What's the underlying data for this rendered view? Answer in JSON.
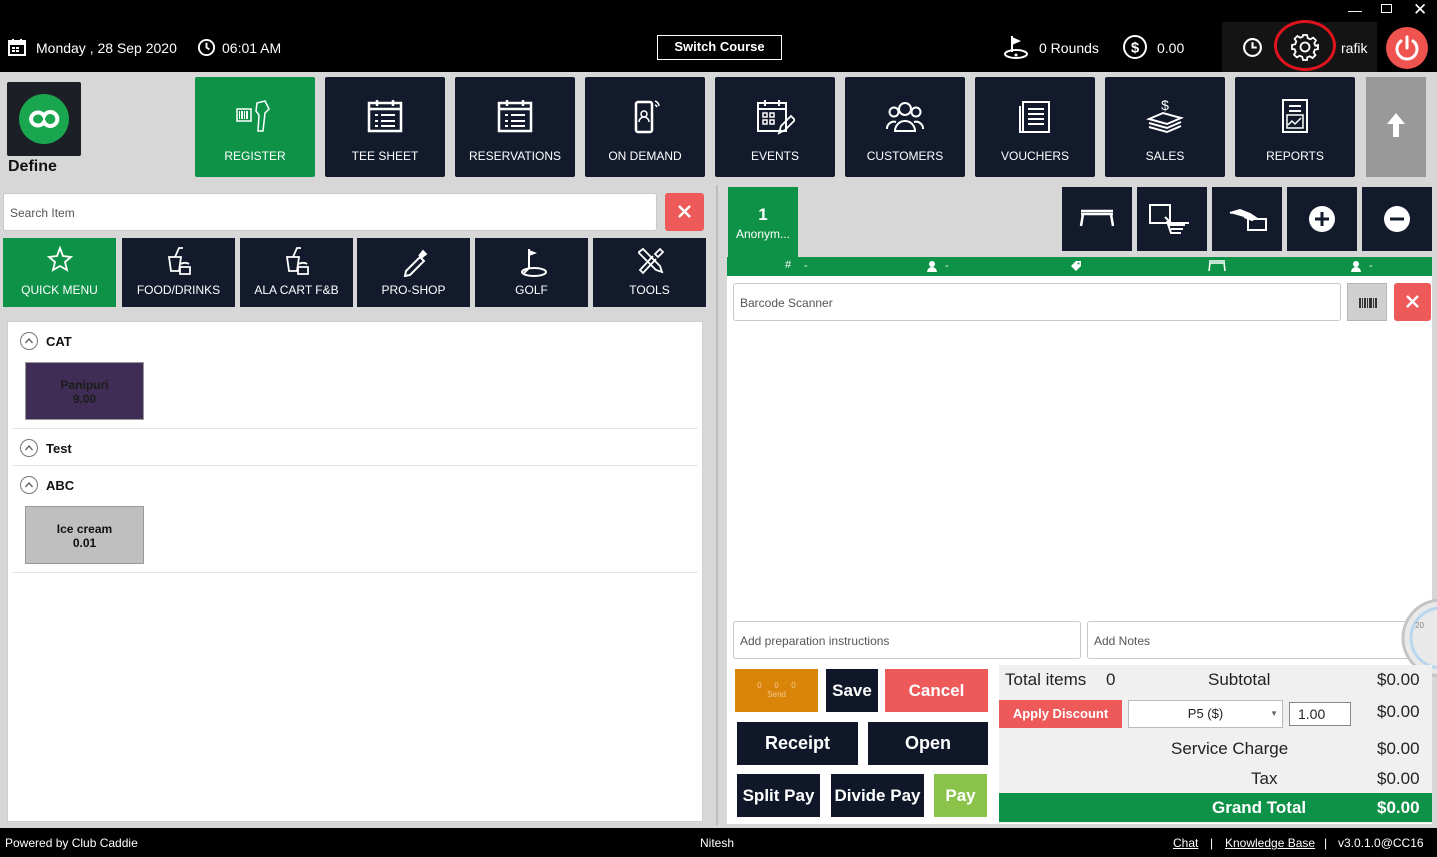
{
  "topbar": {
    "date": "Monday ,  28 Sep 2020",
    "time": "06:01 AM",
    "switch_course": "Switch Course",
    "rounds": "0 Rounds",
    "amount": "0.00",
    "user": "rafik"
  },
  "brand": {
    "label": "Define"
  },
  "nav": [
    {
      "label": "REGISTER",
      "icon": "barcode-scanner-icon"
    },
    {
      "label": "TEE SHEET",
      "icon": "calendar-list-icon"
    },
    {
      "label": "RESERVATIONS",
      "icon": "calendar-list-icon"
    },
    {
      "label": "ON DEMAND",
      "icon": "mobile-icon"
    },
    {
      "label": "EVENTS",
      "icon": "calendar-edit-icon"
    },
    {
      "label": "CUSTOMERS",
      "icon": "users-icon"
    },
    {
      "label": "VOUCHERS",
      "icon": "voucher-icon"
    },
    {
      "label": "SALES",
      "icon": "money-stack-icon"
    },
    {
      "label": "REPORTS",
      "icon": "report-icon"
    }
  ],
  "search": {
    "placeholder": "Search Item"
  },
  "categories": [
    {
      "label": "QUICK MENU"
    },
    {
      "label": "FOOD/DRINKS"
    },
    {
      "label": "ALA CART F&B"
    },
    {
      "label": "PRO-SHOP"
    },
    {
      "label": "GOLF"
    },
    {
      "label": "TOOLS"
    }
  ],
  "groups": [
    {
      "name": "CAT",
      "items": [
        {
          "name": "Panipuri",
          "price": "9.00"
        }
      ]
    },
    {
      "name": "Test",
      "items": []
    },
    {
      "name": "ABC",
      "items": [
        {
          "name": "Ice cream",
          "price": "0.01"
        }
      ]
    }
  ],
  "order_tab": {
    "number": "1",
    "name": "Anonym..."
  },
  "info_bar": {
    "table": "-",
    "guest": "-",
    "tag": "-",
    "seat": "-",
    "person": "-"
  },
  "barcode": {
    "placeholder": "Barcode Scanner"
  },
  "prep": {
    "placeholder": "Add preparation instructions"
  },
  "notes": {
    "placeholder": "Add Notes"
  },
  "send": {
    "label": "Send",
    "counts": [
      "0",
      "0",
      "0"
    ]
  },
  "buttons": {
    "save": "Save",
    "cancel": "Cancel",
    "receipt": "Receipt",
    "open": "Open",
    "split_pay": "Split Pay",
    "divide_pay": "Divide Pay",
    "pay": "Pay",
    "apply_discount": "Apply Discount"
  },
  "summary": {
    "total_items_label": "Total items",
    "total_items": "0",
    "subtotal_label": "Subtotal",
    "subtotal": "$0.00",
    "discount_select": "P5 ($)",
    "discount_value": "1.00",
    "discount_amount": "$0.00",
    "service_label": "Service Charge",
    "service": "$0.00",
    "tax_label": "Tax",
    "tax": "$0.00",
    "grand_label": "Grand Total",
    "grand": "$0.00"
  },
  "gauge": {
    "label": "20"
  },
  "footer": {
    "powered": "Powered by Club Caddie",
    "center": "Nitesh",
    "chat": "Chat",
    "sep1": "|",
    "kb": "Knowledge Base",
    "sep2": "|",
    "version": "v3.0.1.0@CC16"
  },
  "colors": {
    "green": "#0e9248",
    "dark": "#121a2b",
    "red": "#ee5a5a",
    "purple": "#3f2d55",
    "pay_green": "#8bc34a",
    "send_orange": "#d9850a"
  }
}
